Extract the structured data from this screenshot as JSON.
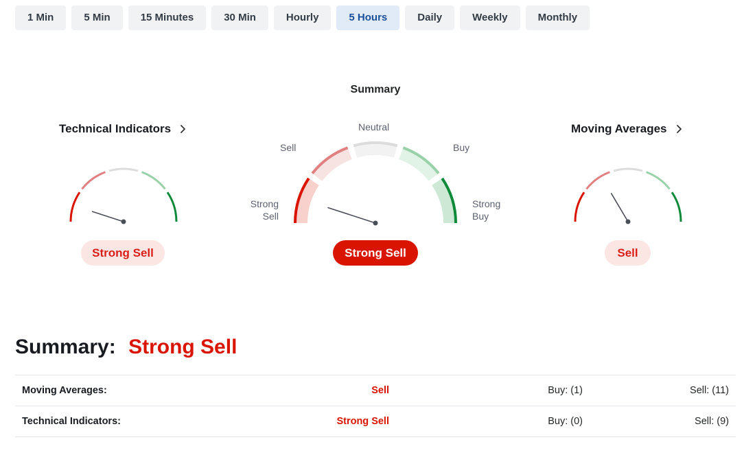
{
  "timeframes": {
    "tabs": [
      "1 Min",
      "5 Min",
      "15 Minutes",
      "30 Min",
      "Hourly",
      "5 Hours",
      "Daily",
      "Weekly",
      "Monthly"
    ],
    "active": "5 Hours"
  },
  "gauges": {
    "summary_title": "Summary",
    "technical": {
      "title": "Technical Indicators",
      "result": "Strong Sell",
      "level": 0.1
    },
    "summary": {
      "labels": {
        "strong_sell_1": "Strong",
        "strong_sell_2": "Sell",
        "sell": "Sell",
        "neutral": "Neutral",
        "buy": "Buy",
        "strong_buy_1": "Strong",
        "strong_buy_2": "Buy"
      },
      "result": "Strong Sell",
      "level": 0.1
    },
    "moving": {
      "title": "Moving Averages",
      "result": "Sell",
      "level": 0.33
    }
  },
  "summary_section": {
    "label": "Summary:",
    "value": "Strong Sell",
    "rows": [
      {
        "label": "Moving Averages:",
        "status": "Sell",
        "buy": "Buy: (1)",
        "sell": "Sell: (11)"
      },
      {
        "label": "Technical Indicators:",
        "status": "Strong Sell",
        "buy": "Buy: (0)",
        "sell": "Sell: (9)"
      }
    ]
  },
  "colors": {
    "strong_sell": "#d91400",
    "sell": "#e08080",
    "neutral": "#dcdcdc",
    "buy": "#99d2a8",
    "strong_buy": "#0e8a3a",
    "accent_active": "#1b4f99"
  }
}
